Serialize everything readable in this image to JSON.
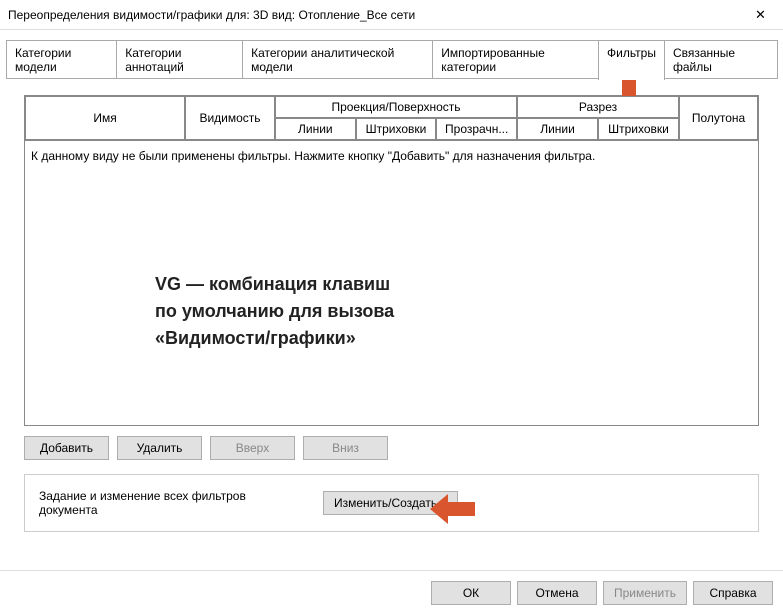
{
  "colors": {
    "arrow": "#d8552e"
  },
  "title": "Переопределения видимости/графики для: 3D вид: Отопление_Все сети",
  "tabs": [
    "Категории модели",
    "Категории аннотаций",
    "Категории аналитической модели",
    "Импортированные категории",
    "Фильтры",
    "Связанные файлы"
  ],
  "active_tab_index": 4,
  "table": {
    "headers": {
      "name": "Имя",
      "visibility": "Видимость",
      "projection": "Проекция/Поверхность",
      "section": "Разрез",
      "halftone": "Полутона",
      "lines": "Линии",
      "patterns": "Штриховки",
      "transparency": "Прозрачн..."
    },
    "empty_message": "К данному виду не были применены фильтры. Нажмите кнопку \"Добавить\" для назначения фильтра."
  },
  "hint": {
    "line1": "VG — комбинация клавиш",
    "line2": "по умолчанию для вызова",
    "line3": "«Видимости/графики»"
  },
  "buttons": {
    "add": "Добавить",
    "remove": "Удалить",
    "up": "Вверх",
    "down": "Вниз",
    "edit_create": "Изменить/Создать..."
  },
  "panel2_text": "Задание и изменение всех фильтров документа",
  "footer": {
    "ok": "ОК",
    "cancel": "Отмена",
    "apply": "Применить",
    "help": "Справка"
  }
}
